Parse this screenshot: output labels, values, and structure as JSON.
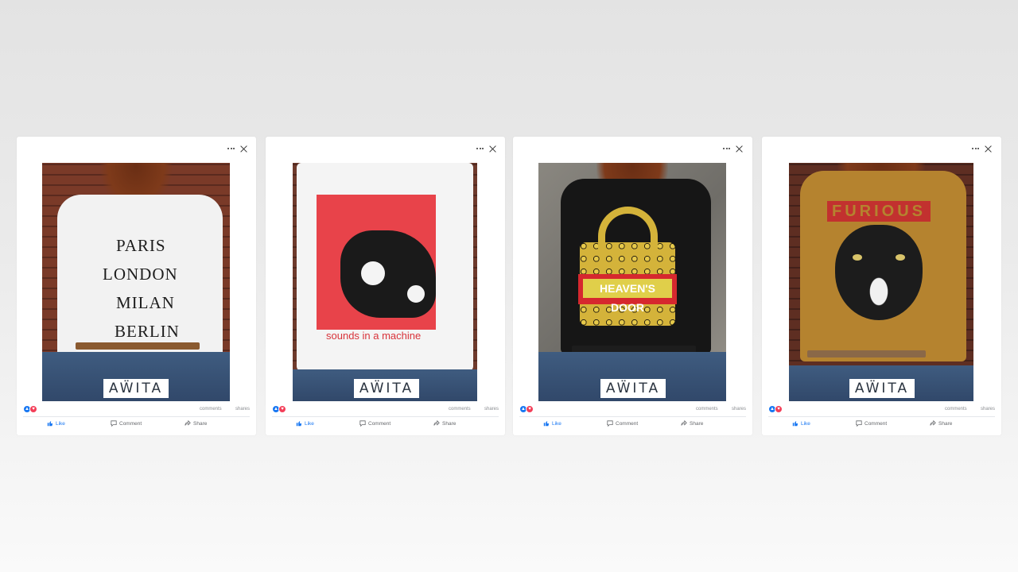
{
  "brand": "AẄITA",
  "colors": {
    "like_blue": "#1877f2",
    "love_red": "#f33e58",
    "text_gray": "#65676b"
  },
  "posts": [
    {
      "shirt": "white",
      "print_lines": [
        "PARIS",
        "LONDON",
        "MILAN",
        "BERLIN"
      ],
      "stats": {
        "comments_label": "comments",
        "shares_label": "shares"
      },
      "actions": {
        "like": "Like",
        "comment": "Comment",
        "share": "Share"
      }
    },
    {
      "shirt": "white-red-tiger",
      "print_lines": [
        "sounds in a machine"
      ],
      "stats": {
        "comments_label": "comments",
        "shares_label": "shares"
      },
      "actions": {
        "like": "Like",
        "comment": "Comment",
        "share": "Share"
      }
    },
    {
      "shirt": "black-leopard-bag",
      "print_lines": [
        "HEAVEN'S DOOR"
      ],
      "stats": {
        "comments_label": "comments",
        "shares_label": "shares"
      },
      "actions": {
        "like": "Like",
        "comment": "Comment",
        "share": "Share"
      }
    },
    {
      "shirt": "mustard-panther",
      "print_lines": [
        "FURIOUS"
      ],
      "stats": {
        "comments_label": "comments",
        "shares_label": "shares"
      },
      "actions": {
        "like": "Like",
        "comment": "Comment",
        "share": "Share"
      }
    }
  ]
}
